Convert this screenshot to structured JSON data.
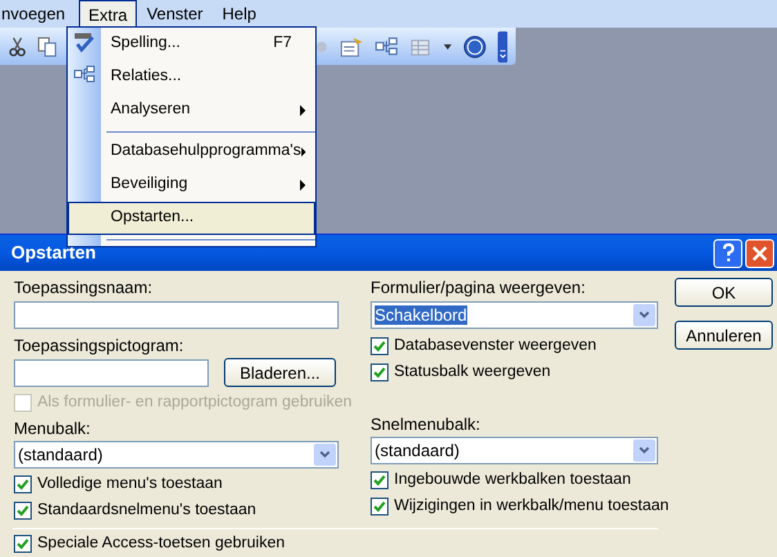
{
  "menubar": [
    {
      "label": "nvoegen",
      "selected": false
    },
    {
      "label": "Extra",
      "selected": true
    },
    {
      "label": "Venster",
      "selected": false
    },
    {
      "label": "Help",
      "selected": false
    }
  ],
  "menu": {
    "items": [
      {
        "kind": "item",
        "label": "Spelling...",
        "shortcut": "F7",
        "submenu": false,
        "selected": false
      },
      {
        "kind": "item",
        "label": "Relaties...",
        "submenu": false,
        "selected": false
      },
      {
        "kind": "item",
        "label": "Analyseren",
        "submenu": true,
        "selected": false
      },
      {
        "kind": "separator"
      },
      {
        "kind": "item",
        "label": "Databasehulpprogramma's",
        "submenu": true,
        "selected": false
      },
      {
        "kind": "item",
        "label": "Beveiliging",
        "submenu": true,
        "selected": false
      },
      {
        "kind": "item",
        "label": "Opstarten...",
        "submenu": false,
        "selected": true
      },
      {
        "kind": "separator"
      }
    ]
  },
  "dialog": {
    "title": "Opstarten",
    "app_title": {
      "label": "Toepassingsnaam:"
    },
    "app_icon": {
      "label": "Toepassingspictogram:",
      "button": "Bladeren..."
    },
    "use_as_form_icon": {
      "label": "Als formulier- en rapportpictogram gebruiken",
      "checked": false,
      "disabled": true
    },
    "menu_bar": {
      "label": "Menubalk:",
      "value": "(standaard)"
    },
    "menu_checks": [
      {
        "label": "Volledige menu's toestaan",
        "checked": true,
        "disabled": false
      },
      {
        "label": "Standaardsnelmenu's toestaan",
        "checked": true,
        "disabled": false
      }
    ],
    "display_form": {
      "label": "Formulier/pagina weergeven:",
      "value": "Schakelbord"
    },
    "display_checks": [
      {
        "label": "Databasevenster weergeven",
        "checked": true,
        "disabled": false
      },
      {
        "label": "Statusbalk weergeven",
        "checked": true,
        "disabled": false
      }
    ],
    "shortcut_menu_bar": {
      "label": "Snelmenubalk:",
      "value": "(standaard)"
    },
    "toolbar_checks": [
      {
        "label": "Ingebouwde werkbalken toestaan",
        "checked": true,
        "disabled": false
      },
      {
        "label": "Wijzigingen in werkbalk/menu toestaan",
        "checked": true,
        "disabled": false
      }
    ],
    "special_keys": {
      "label": "Speciale Access-toetsen gebruiken",
      "checked": true,
      "disabled": false
    },
    "buttons": [
      "OK",
      "Annuleren"
    ]
  }
}
